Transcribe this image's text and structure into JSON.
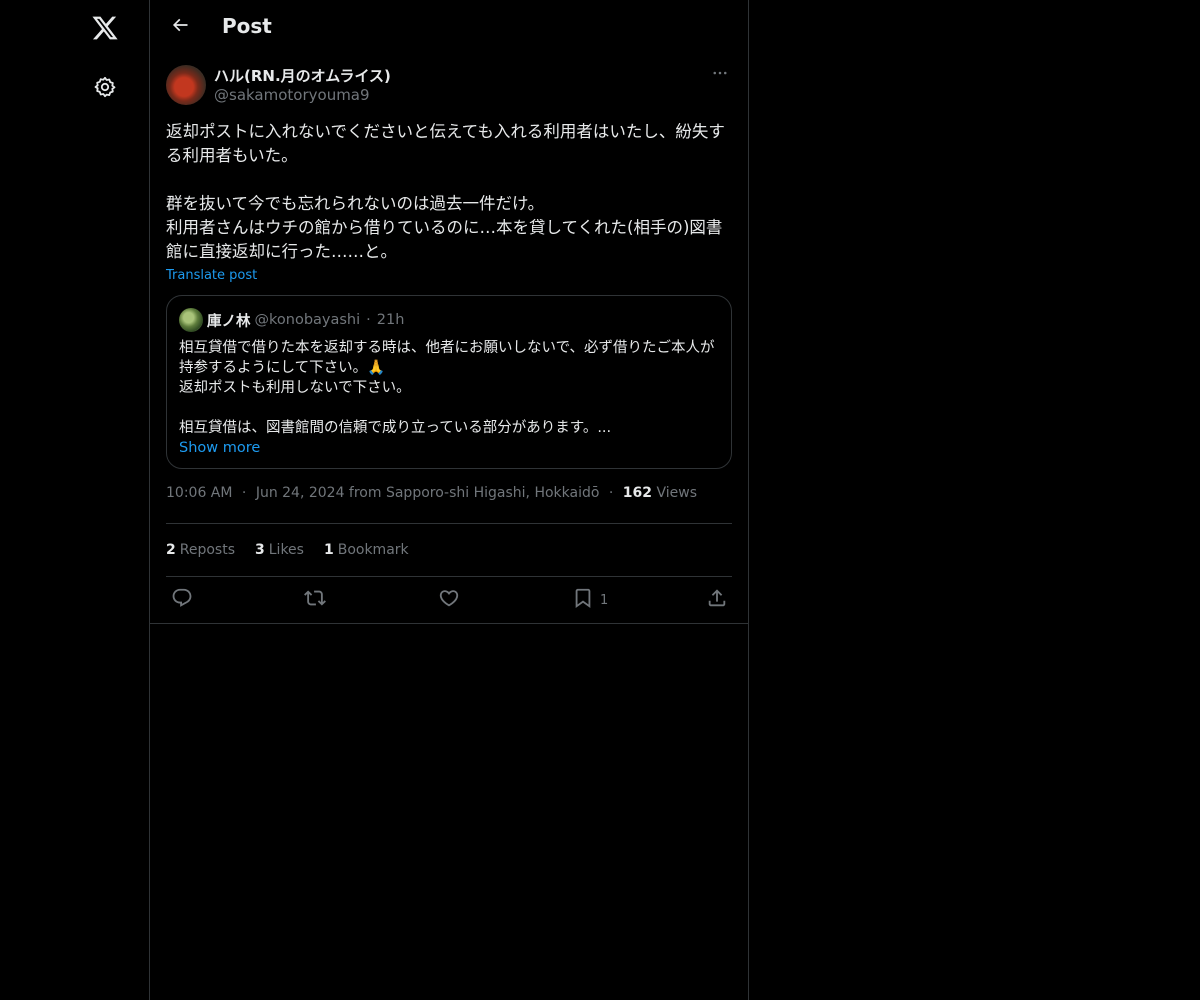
{
  "header": {
    "title": "Post"
  },
  "post": {
    "author_name": "ハル(RN.月のオムライス)",
    "author_handle": "@sakamotoryouma9",
    "text": "返却ポストに入れないでくださいと伝えても入れる利用者はいたし、紛失する利用者もいた。\n\n群を抜いて今でも忘れられないのは過去一件だけ。\n利用者さんはウチの館から借りているのに…本を貸してくれた(相手の)図書館に直接返却に行った……と。",
    "translate_label": "Translate post",
    "quote": {
      "name": "庫ノ林",
      "handle": "@konobayashi",
      "separator": "·",
      "time": "21h",
      "text": "相互貸借で借りた本を返却する時は、他者にお願いしないで、必ず借りたご本人が持参するようにして下さい。🙏\n返却ポストも利用しないで下さい。\n\n相互貸借は、図書館間の信頼で成り立っている部分があります。...",
      "show_more": "Show more"
    },
    "meta": {
      "time": "10:06 AM",
      "sep1": "·",
      "date_location": "Jun 24, 2024 from Sapporo-shi Higashi, Hokkaidō",
      "sep2": "·",
      "views_count": "162",
      "views_label": "Views"
    },
    "stats": {
      "reposts_count": "2",
      "reposts_label": "Reposts",
      "likes_count": "3",
      "likes_label": "Likes",
      "bookmarks_count": "1",
      "bookmarks_label": "Bookmark"
    },
    "actions": {
      "bookmark_count": "1"
    }
  },
  "icons": {
    "logo": "x-logo-icon",
    "settings": "gear-icon",
    "back": "arrow-left-icon",
    "more": "more-horizontal-icon",
    "reply": "reply-icon",
    "repost": "repost-icon",
    "like": "heart-icon",
    "bookmark": "bookmark-icon",
    "share": "share-icon"
  },
  "colors": {
    "background": "#000000",
    "text": "#e7e9ea",
    "muted": "#71767b",
    "accent": "#1d9bf0",
    "border": "#2f3336"
  }
}
